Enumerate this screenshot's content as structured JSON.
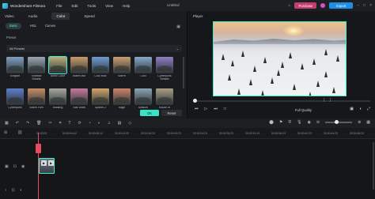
{
  "app": {
    "name": "Wondershare Filmora",
    "project": "Untitled"
  },
  "menu": [
    "File",
    "Edit",
    "Tools",
    "View",
    "Help"
  ],
  "top_buttons": {
    "purchase": "Purchase",
    "export": "Export"
  },
  "left_tabs": [
    "Video",
    "Audio",
    "Color",
    "Speed"
  ],
  "sub_tabs": [
    "Basic",
    "HSL",
    "Curves"
  ],
  "preset": {
    "label": "Preset",
    "dropdown": "All Presets"
  },
  "presets": [
    {
      "label": "Elegant",
      "color": "#7fa0c0"
    },
    {
      "label": "Shadow Details",
      "color": "#9aa5b1"
    },
    {
      "label": "Bond Color",
      "color": "#b9b07e"
    },
    {
      "label": "Warm Mid",
      "color": "#c79c6a"
    },
    {
      "label": "Cool Max",
      "color": "#6d9bd1"
    },
    {
      "label": "Warm",
      "color": "#caa071"
    },
    {
      "label": "Cool",
      "color": "#87a9c8"
    },
    {
      "label": "Cyberpunk Details",
      "color": "#8f7fc2"
    },
    {
      "label": "Cyberpunk",
      "color": "#5d7ec9"
    },
    {
      "label": "Warm Film",
      "color": "#c48e67"
    },
    {
      "label": "Walking",
      "color": "#a6a8a0"
    },
    {
      "label": "Star Wars",
      "color": "#c47b9a"
    },
    {
      "label": "Sparks 2",
      "color": "#cfa56c"
    },
    {
      "label": "Rage",
      "color": "#c9846a"
    },
    {
      "label": "Mission",
      "color": "#8aa5b2"
    },
    {
      "label": "House of",
      "color": "#a89f86"
    }
  ],
  "buttons": {
    "ok": "OK",
    "reset": "Reset"
  },
  "player": {
    "label": "Player",
    "quality": "Full Quality"
  },
  "timeline": {
    "ticks": [
      "00:00:00",
      "00:00:04:02",
      "00:00:08:14",
      "00:00:12:20",
      "00:00:16:23",
      "00:00:20:23",
      "00:00:24:23",
      "00:00:28:23",
      "00:00:32:23",
      "00:00:36:23",
      "00:00:40:23",
      "00:00:44:23",
      "00:00:48:23"
    ]
  }
}
